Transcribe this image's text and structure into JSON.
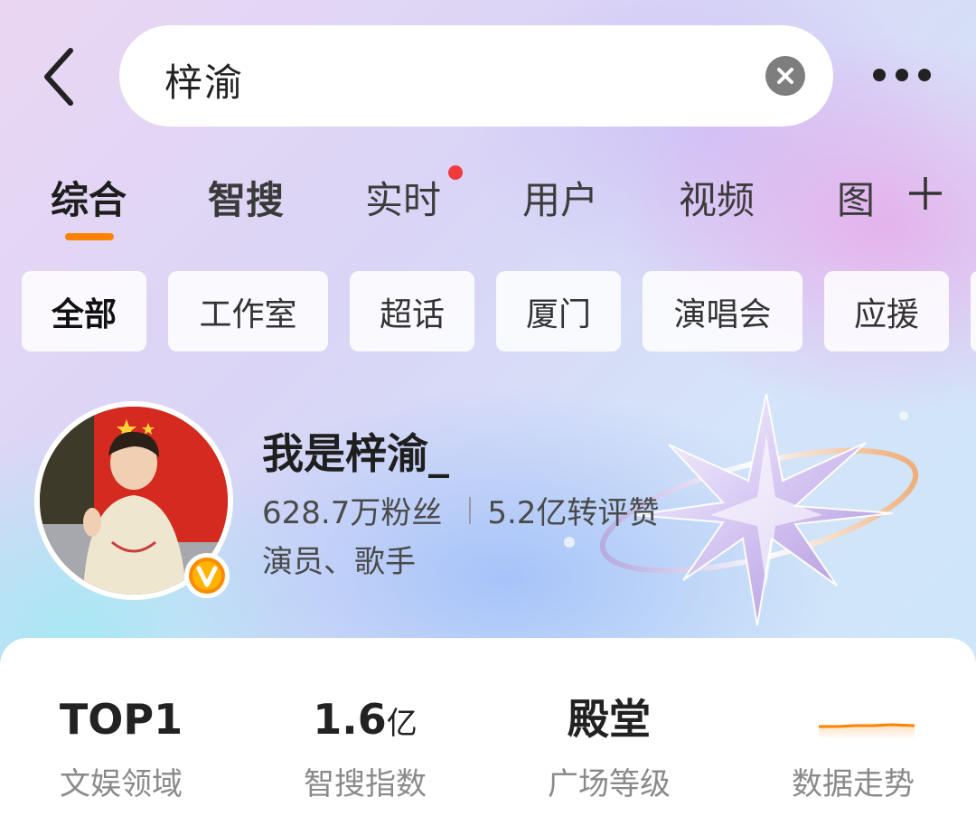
{
  "search": {
    "query": "梓渝"
  },
  "tabs": [
    {
      "label": "综合",
      "active": true
    },
    {
      "label": "智搜"
    },
    {
      "label": "实时",
      "has_dot": true
    },
    {
      "label": "用户"
    },
    {
      "label": "视频"
    },
    {
      "label": "图"
    }
  ],
  "chips": [
    {
      "label": "全部",
      "selected": true
    },
    {
      "label": "工作室"
    },
    {
      "label": "超话"
    },
    {
      "label": "厦门"
    },
    {
      "label": "演唱会"
    },
    {
      "label": "应援"
    }
  ],
  "profile": {
    "name": "我是梓渝_",
    "fans": "628.7万粉丝",
    "interactions": "5.2亿转评赞",
    "role": "演员、歌手",
    "verified": true
  },
  "metrics": [
    {
      "value": "TOP1",
      "unit": "",
      "label": "文娱领域"
    },
    {
      "value": "1.6",
      "unit": "亿",
      "label": "智搜指数"
    },
    {
      "value": "殿堂",
      "unit": "",
      "label": "广场等级"
    },
    {
      "value": "",
      "unit": "",
      "label": "数据走势"
    }
  ],
  "colors": {
    "accent": "#ff8200",
    "notification_dot": "#f23b3b",
    "verify_badge": "#ff8a00"
  },
  "icons": {
    "back": "chevron-left-icon",
    "clear": "close-icon",
    "more": "more-horizontal-icon",
    "add": "plus-icon",
    "verified": "verified-v-icon"
  }
}
